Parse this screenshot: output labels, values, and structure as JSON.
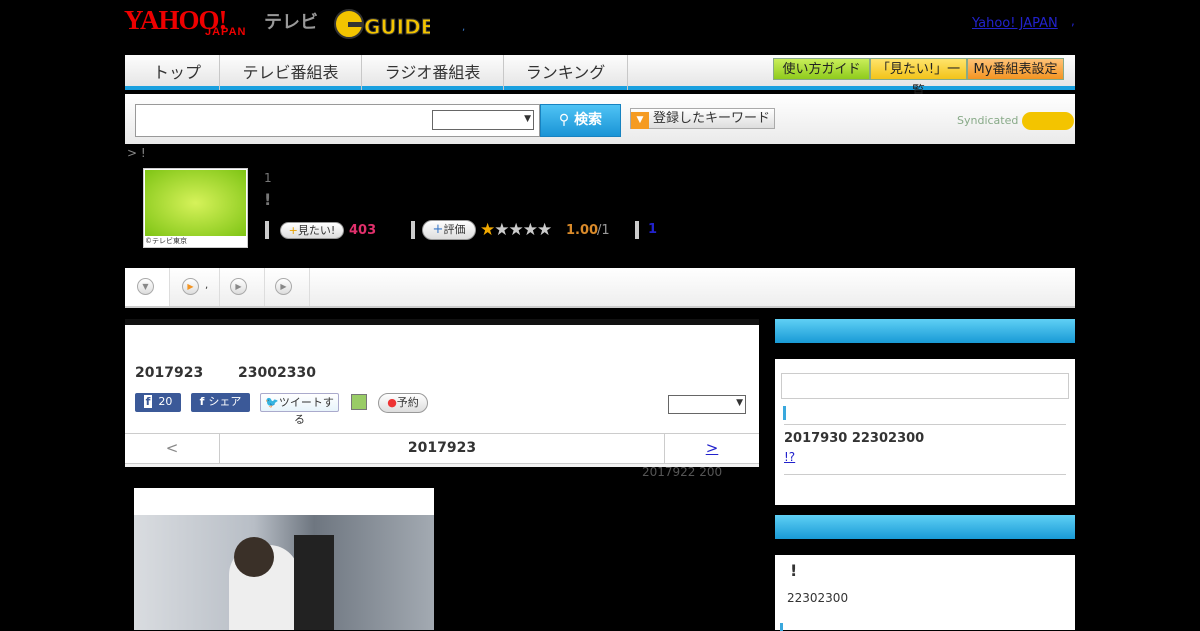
{
  "header": {
    "logo_yahoo": "YAHOO!",
    "logo_japan": "JAPAN",
    "logo_tv": "テレビ",
    "logo_gguide": "GUIDE",
    "yj_link": "Yahoo! JAPAN",
    "dot": ",",
    "mid_dot": ","
  },
  "nav": {
    "tabs": [
      "トップ",
      "テレビ番組表",
      "ラジオ番組表",
      "ランキング"
    ],
    "buttons": [
      "使い方ガイド",
      "「見たい!」一覧",
      "My番組表設定"
    ]
  },
  "search": {
    "button": "検索",
    "keyword_button": "登録したキーワード",
    "syndicated": "Syndicated"
  },
  "breadcrumb": "> !",
  "program": {
    "thumb_caption": "©テレビ東京",
    "episode": "1",
    "title": "!",
    "mitai_label": "見たい!",
    "mitai_count": "403",
    "hyouka_label": "評価",
    "stars": "★★★★★",
    "rating": "1.00",
    "rating_den": "/1",
    "review_count": "1"
  },
  "subtabs": {
    "tab2_dot": ","
  },
  "main": {
    "date": "2017923",
    "time": "23002330",
    "share_count": "20",
    "fb_share": "シェア",
    "tweet": "ツイートする",
    "reserve": "予約",
    "prev": "<",
    "current_date": "2017923",
    "next": ">",
    "updated": "2017922  200"
  },
  "sidebar": {
    "item_text": "2017930  22302300",
    "item_link": "!?",
    "box2_excl": "!",
    "box2_time": "22302300"
  },
  "colors": {
    "accent": "#19a0df",
    "red_count": "#e1306c",
    "rating": "#d98a2a"
  }
}
